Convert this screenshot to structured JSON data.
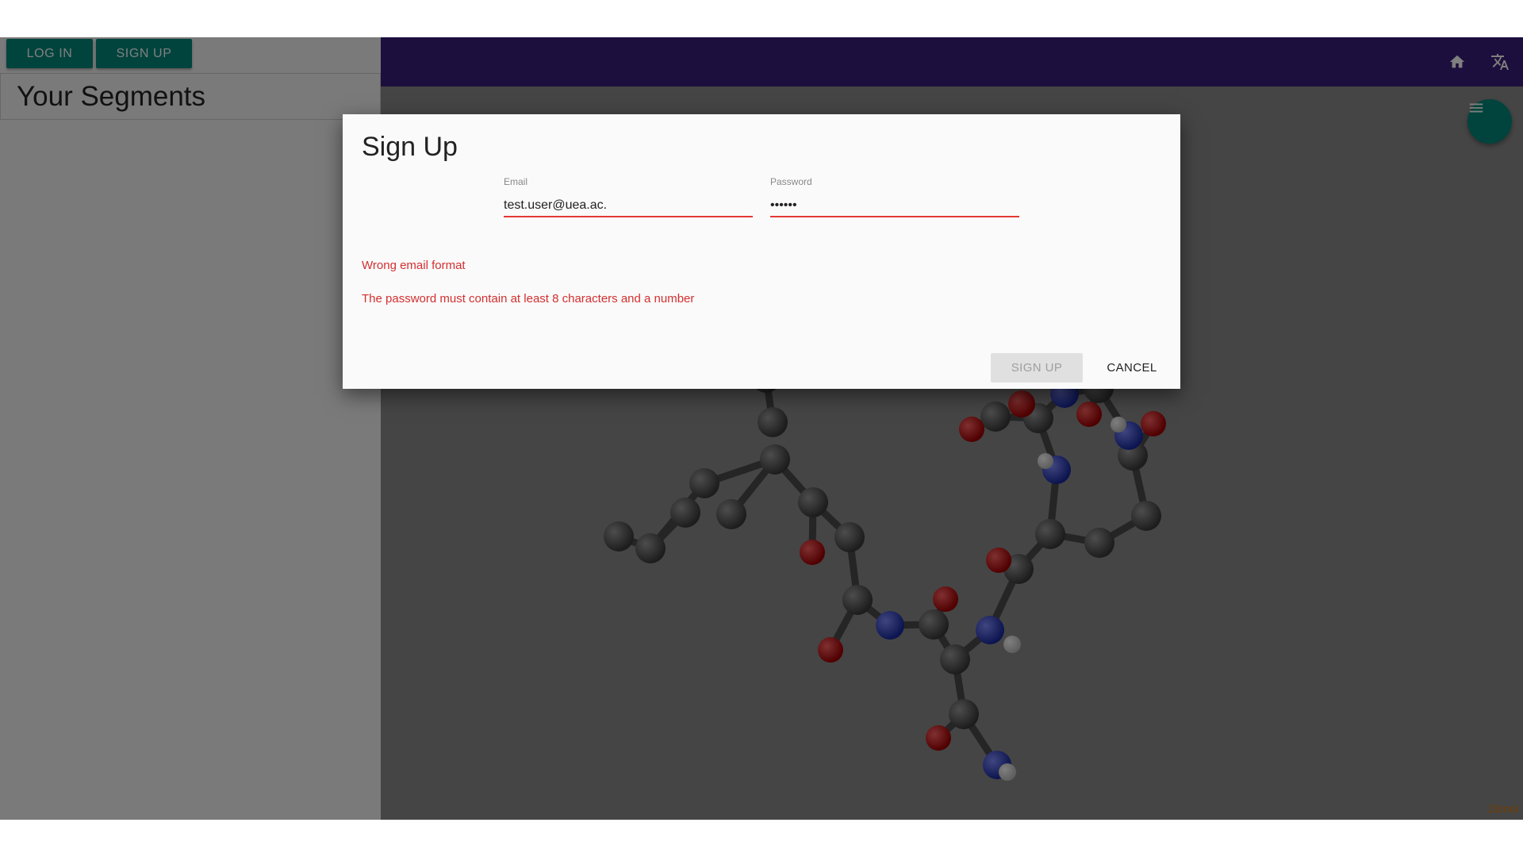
{
  "sidebar": {
    "login_label": "LOG IN",
    "signup_label": "SIGN UP",
    "segments_title": "Your Segments"
  },
  "topbar": {
    "home_icon": "home-icon",
    "translate_icon": "translate-icon"
  },
  "viewer": {
    "menu_icon": "menu-icon",
    "watermark": "JSmol"
  },
  "dialog": {
    "title": "Sign Up",
    "email": {
      "label": "Email",
      "value": "test.user@uea.ac."
    },
    "password": {
      "label": "Password",
      "value": "••••••"
    },
    "errors": [
      "Wrong email format",
      "The password must contain at least 8 characters and a number"
    ],
    "signup_button": "SIGN UP",
    "cancel_button": "CANCEL"
  },
  "colors": {
    "accent": "#00897b",
    "topbar": "#3a1f7a",
    "error": "#d32f2f"
  }
}
